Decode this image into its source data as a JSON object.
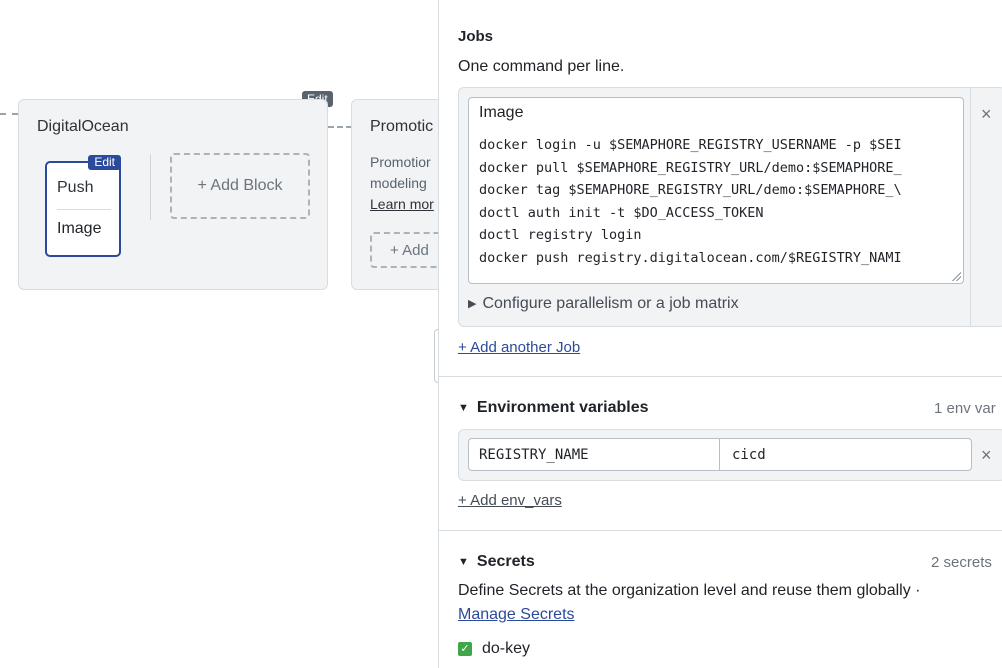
{
  "canvas": {
    "block_edit_label": "Edit",
    "block": {
      "title": "DigitalOcean",
      "job_edit_label": "Edit",
      "jobs": [
        "Push",
        "Image"
      ],
      "add_block_label": "+ Add Block"
    },
    "promo_block": {
      "title": "Promotic",
      "text_line1": "Promotior",
      "text_line2": "modeling",
      "learn_more": "Learn mor",
      "add_label": "+ Add"
    }
  },
  "panel": {
    "jobs": {
      "title": "Jobs",
      "subtitle": "One command per line.",
      "job_name": "Image",
      "commands": "docker login -u $SEMAPHORE_REGISTRY_USERNAME -p $SEI\ndocker pull $SEMAPHORE_REGISTRY_URL/demo:$SEMAPHORE_\ndocker tag $SEMAPHORE_REGISTRY_URL/demo:$SEMAPHORE_\\\ndoctl auth init -t $DO_ACCESS_TOKEN\ndoctl registry login\ndocker push registry.digitalocean.com/$REGISTRY_NAMI",
      "remove_icon": "×",
      "parallelism_label": "Configure parallelism or a job matrix",
      "add_job_label": "+ Add another Job"
    },
    "env_vars": {
      "title": "Environment variables",
      "count": "1 env var",
      "name": "REGISTRY_NAME",
      "value": "cicd",
      "remove_icon": "×",
      "add_label": "+ Add env_vars"
    },
    "secrets": {
      "title": "Secrets",
      "count": "2 secrets",
      "description": "Define Secrets at the organization level and reuse them globally ·",
      "manage_label": "Manage Secrets",
      "items": [
        {
          "name": "do-key",
          "checked": true
        }
      ]
    }
  },
  "icons": {
    "expand": "▶",
    "collapse": "▼",
    "check": "✓"
  },
  "colors": {
    "accent_blue": "#2b4a9b",
    "edit_gray": "#59636e",
    "check_green": "#3fa64a"
  }
}
